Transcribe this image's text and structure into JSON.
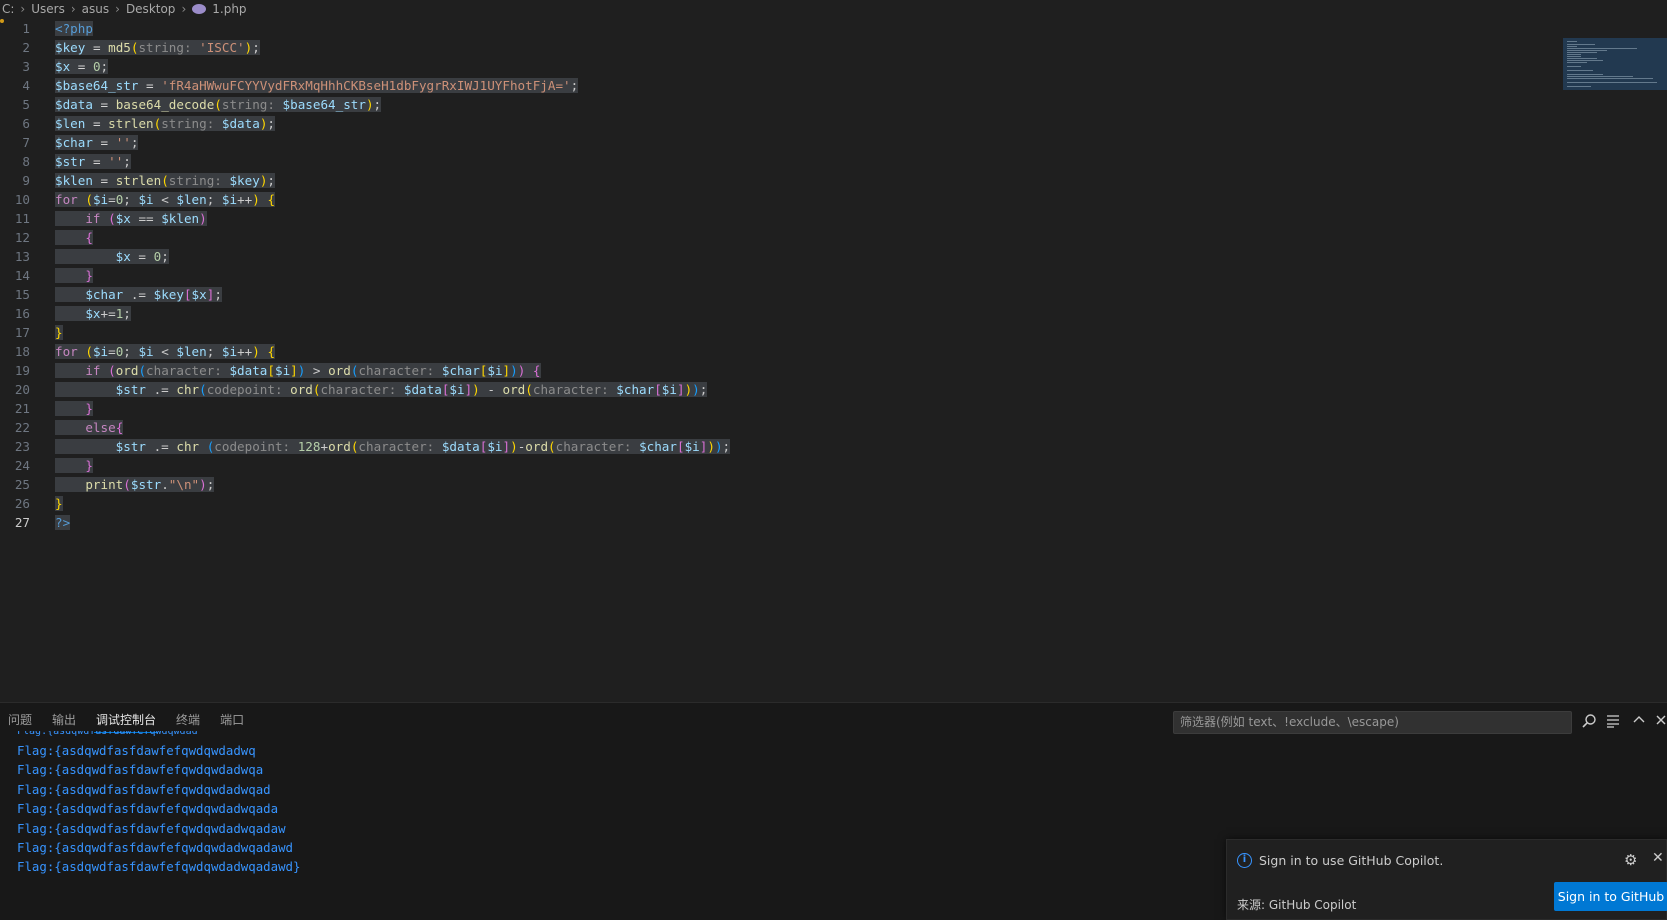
{
  "breadcrumb": {
    "drive": "C:",
    "parts": [
      "Users",
      "asus",
      "Desktop"
    ],
    "file": "1.php",
    "file_icon": "php-elephant-icon"
  },
  "editor": {
    "active_line": 27,
    "line_numbers": [
      "1",
      "2",
      "3",
      "4",
      "5",
      "6",
      "7",
      "8",
      "9",
      "10",
      "11",
      "12",
      "13",
      "14",
      "15",
      "16",
      "17",
      "18",
      "19",
      "20",
      "21",
      "22",
      "23",
      "24",
      "25",
      "26",
      "27"
    ]
  },
  "panel": {
    "tabs": [
      "问题",
      "输出",
      "调试控制台",
      "终端",
      "端口"
    ],
    "active_tab": "调试控制台",
    "filter_placeholder": "筛选器(例如 text、!exclude、\\escape)",
    "output_lines": [
      "Flag:{asdqwdfasfdawfefqwdqwdadwq",
      "Flag:{asdqwdfasfdawfefqwdqwdadwqa",
      "Flag:{asdqwdfasfdawfefqwdqwdadwqad",
      "Flag:{asdqwdfasfdawfefqwdqwdadwqada",
      "Flag:{asdqwdfasfdawfefqwdqwdadwqadaw",
      "Flag:{asdqwdfasfdawfefqwdqwdadwqadawd",
      "Flag:{asdqwdfasfdawfefqwdqwdadwqadawd}"
    ]
  },
  "notification": {
    "message": "Sign in to use GitHub Copilot.",
    "source": "来源: GitHub Copilot",
    "button": "Sign in to GitHub"
  },
  "colors": {
    "accent": "#0078d4",
    "output_text": "#3794ff",
    "background": "#1f1f1f"
  }
}
